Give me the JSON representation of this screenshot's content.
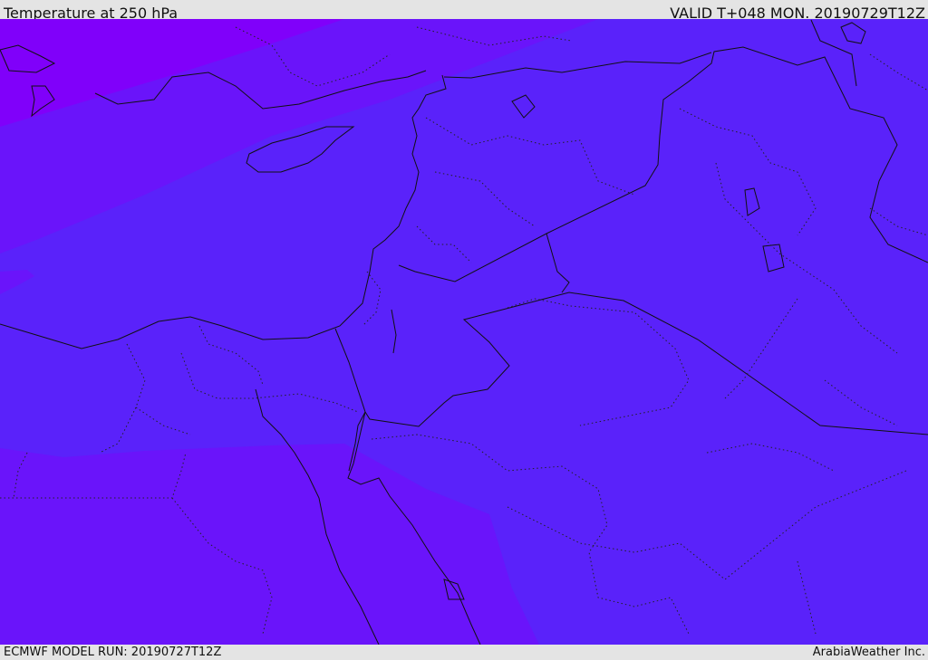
{
  "header": {
    "title": "Temperature at 250 hPa",
    "valid": "VALID T+048 MON. 20190729T12Z"
  },
  "footer": {
    "model_run": "ECMWF MODEL RUN: 20190727T12Z",
    "credit": "ArabiaWeather Inc."
  },
  "map": {
    "colors": {
      "band_coldest": "#8000fa",
      "band_mid": "#6a14fa",
      "band_main": "#5a22fa",
      "borders": "#111111"
    }
  }
}
